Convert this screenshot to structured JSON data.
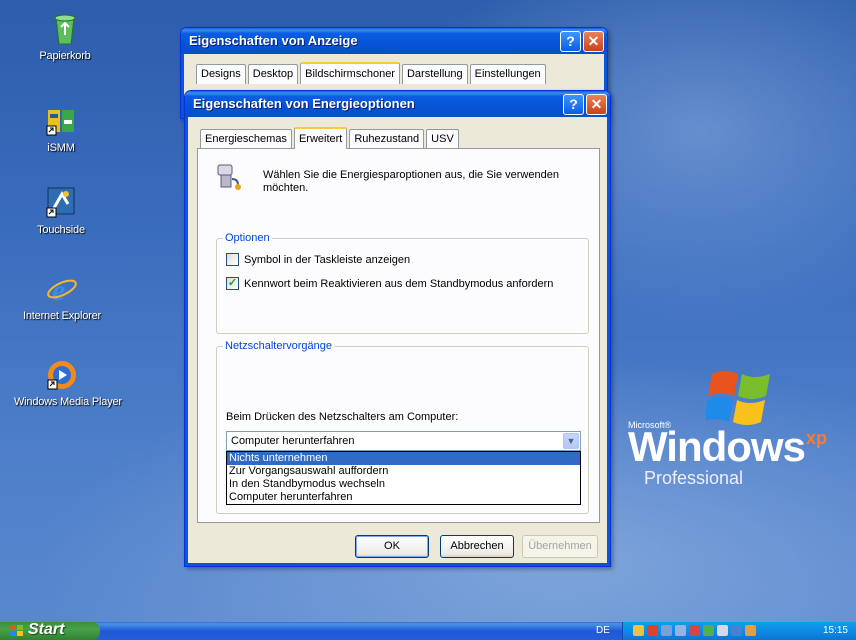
{
  "desktop": {
    "icons": [
      {
        "label": "Papierkorb",
        "icon": "recycle-bin-icon"
      },
      {
        "label": "iSMM",
        "icon": "ismm-shortcut-icon"
      },
      {
        "label": "Touchside",
        "icon": "touchside-shortcut-icon"
      },
      {
        "label": "Internet Explorer",
        "icon": "internet-explorer-icon"
      },
      {
        "label": "Windows Media Player",
        "icon": "windows-media-player-icon"
      }
    ],
    "logo": {
      "microsoft": "Microsoft®",
      "windows": "Windows",
      "xp": "xp",
      "edition": "Professional",
      "tm": "™"
    }
  },
  "display_window": {
    "title": "Eigenschaften von Anzeige",
    "tabs": [
      "Designs",
      "Desktop",
      "Bildschirmschoner",
      "Darstellung",
      "Einstellungen"
    ],
    "active_tab": "Bildschirmschoner"
  },
  "power_window": {
    "title": "Eigenschaften von Energieoptionen",
    "tabs": [
      "Energieschemas",
      "Erweitert",
      "Ruhezustand",
      "USV"
    ],
    "active_tab": "Erweitert",
    "intro_line1": "Wählen Sie die Energiesparoptionen aus, die Sie verwenden",
    "intro_line2": "möchten.",
    "options_group": "Optionen",
    "checkbox_tray": {
      "label": "Symbol in der Taskleiste anzeigen",
      "checked": false
    },
    "checkbox_password": {
      "label": "Kennwort beim Reaktivieren aus dem Standbymodus anfordern",
      "checked": true
    },
    "power_group": "Netzschaltervorgänge",
    "power_button_label": "Beim Drücken des Netzschalters am Computer:",
    "power_button_value": "Computer herunterfahren",
    "dropdown_options": [
      "Nichts unternehmen",
      "Zur Vorgangsauswahl auffordern",
      "In den Standbymodus wechseln",
      "Computer herunterfahren"
    ],
    "highlighted_option": "Nichts unternehmen",
    "ok": "OK",
    "cancel": "Abbrechen",
    "apply": "Übernehmen"
  },
  "taskbar": {
    "start": "Start",
    "language": "DE",
    "clock": "15:15"
  },
  "colors": {
    "accent": "#0a5ee0",
    "selection": "#316ac5",
    "start_green": "#3c8f3c"
  }
}
